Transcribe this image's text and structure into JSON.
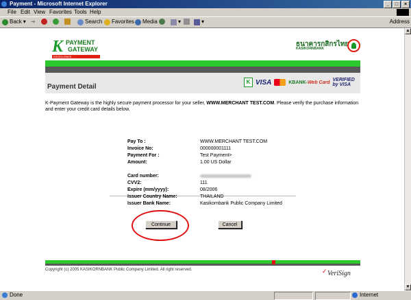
{
  "window": {
    "title": "Payment - Microsoft Internet Explorer",
    "controls": [
      "_",
      "□",
      "×"
    ]
  },
  "menu": [
    "File",
    "Edit",
    "View",
    "Favorites",
    "Tools",
    "Help"
  ],
  "toolbar": {
    "back": "Back",
    "search": "Search",
    "favorites": "Favorites",
    "media": "Media",
    "address_label": "Address"
  },
  "page": {
    "logo_line1": "PAYMENT",
    "logo_line2": "GATEWAY",
    "logo_tag": "EXCELLENCE",
    "bank_thai": "ธนาคารกสิกรไทย",
    "bank_en": "KASIKORNBANK",
    "section_title": "Payment Detail",
    "card_logos": {
      "visa": "VISA",
      "kweb": "KBANK-",
      "kweb_web": "Web Card",
      "vbv_line1": "VERIFIED",
      "vbv_line2": "by VISA"
    },
    "intro_part1": "K-Payment Gateway is the highly secure payment processor for your seller, ",
    "intro_merchant": "WWW.MERCHANT TEST.COM",
    "intro_part2": ". Please verify the purchase information and enter your credit card details below.",
    "order": [
      {
        "label": "Pay To :",
        "value": "WWW.MERCHANT TEST.COM"
      },
      {
        "label": "Invoice No:",
        "value": "000000001111"
      },
      {
        "label": "Payment For :",
        "value": "Test Payment>"
      },
      {
        "label": "Amount:",
        "value": "1.00 US Dollar"
      }
    ],
    "card": [
      {
        "label": "Card number:",
        "value": ""
      },
      {
        "label": "CVV2:",
        "value": "111"
      },
      {
        "label": "Expire (mm/yyyy):",
        "value": "08/2006"
      },
      {
        "label": "Issuer Country Name:",
        "value": "THAILAND"
      },
      {
        "label": "Issuer Bank Name:",
        "value": "Kasikornbank Public Company Limited"
      }
    ],
    "continue_label": "Continue",
    "cancel_label": "Cancel",
    "copyright": "Copyright (c) 2005 KASIKORNBANK Public Company Limited. All right reserved.",
    "verisign": "VeriSign"
  },
  "status": {
    "left": "Done",
    "zone": "Internet"
  },
  "colors": {
    "green": "#2dc82d",
    "gray": "#595959",
    "highlight": "#e01010"
  }
}
